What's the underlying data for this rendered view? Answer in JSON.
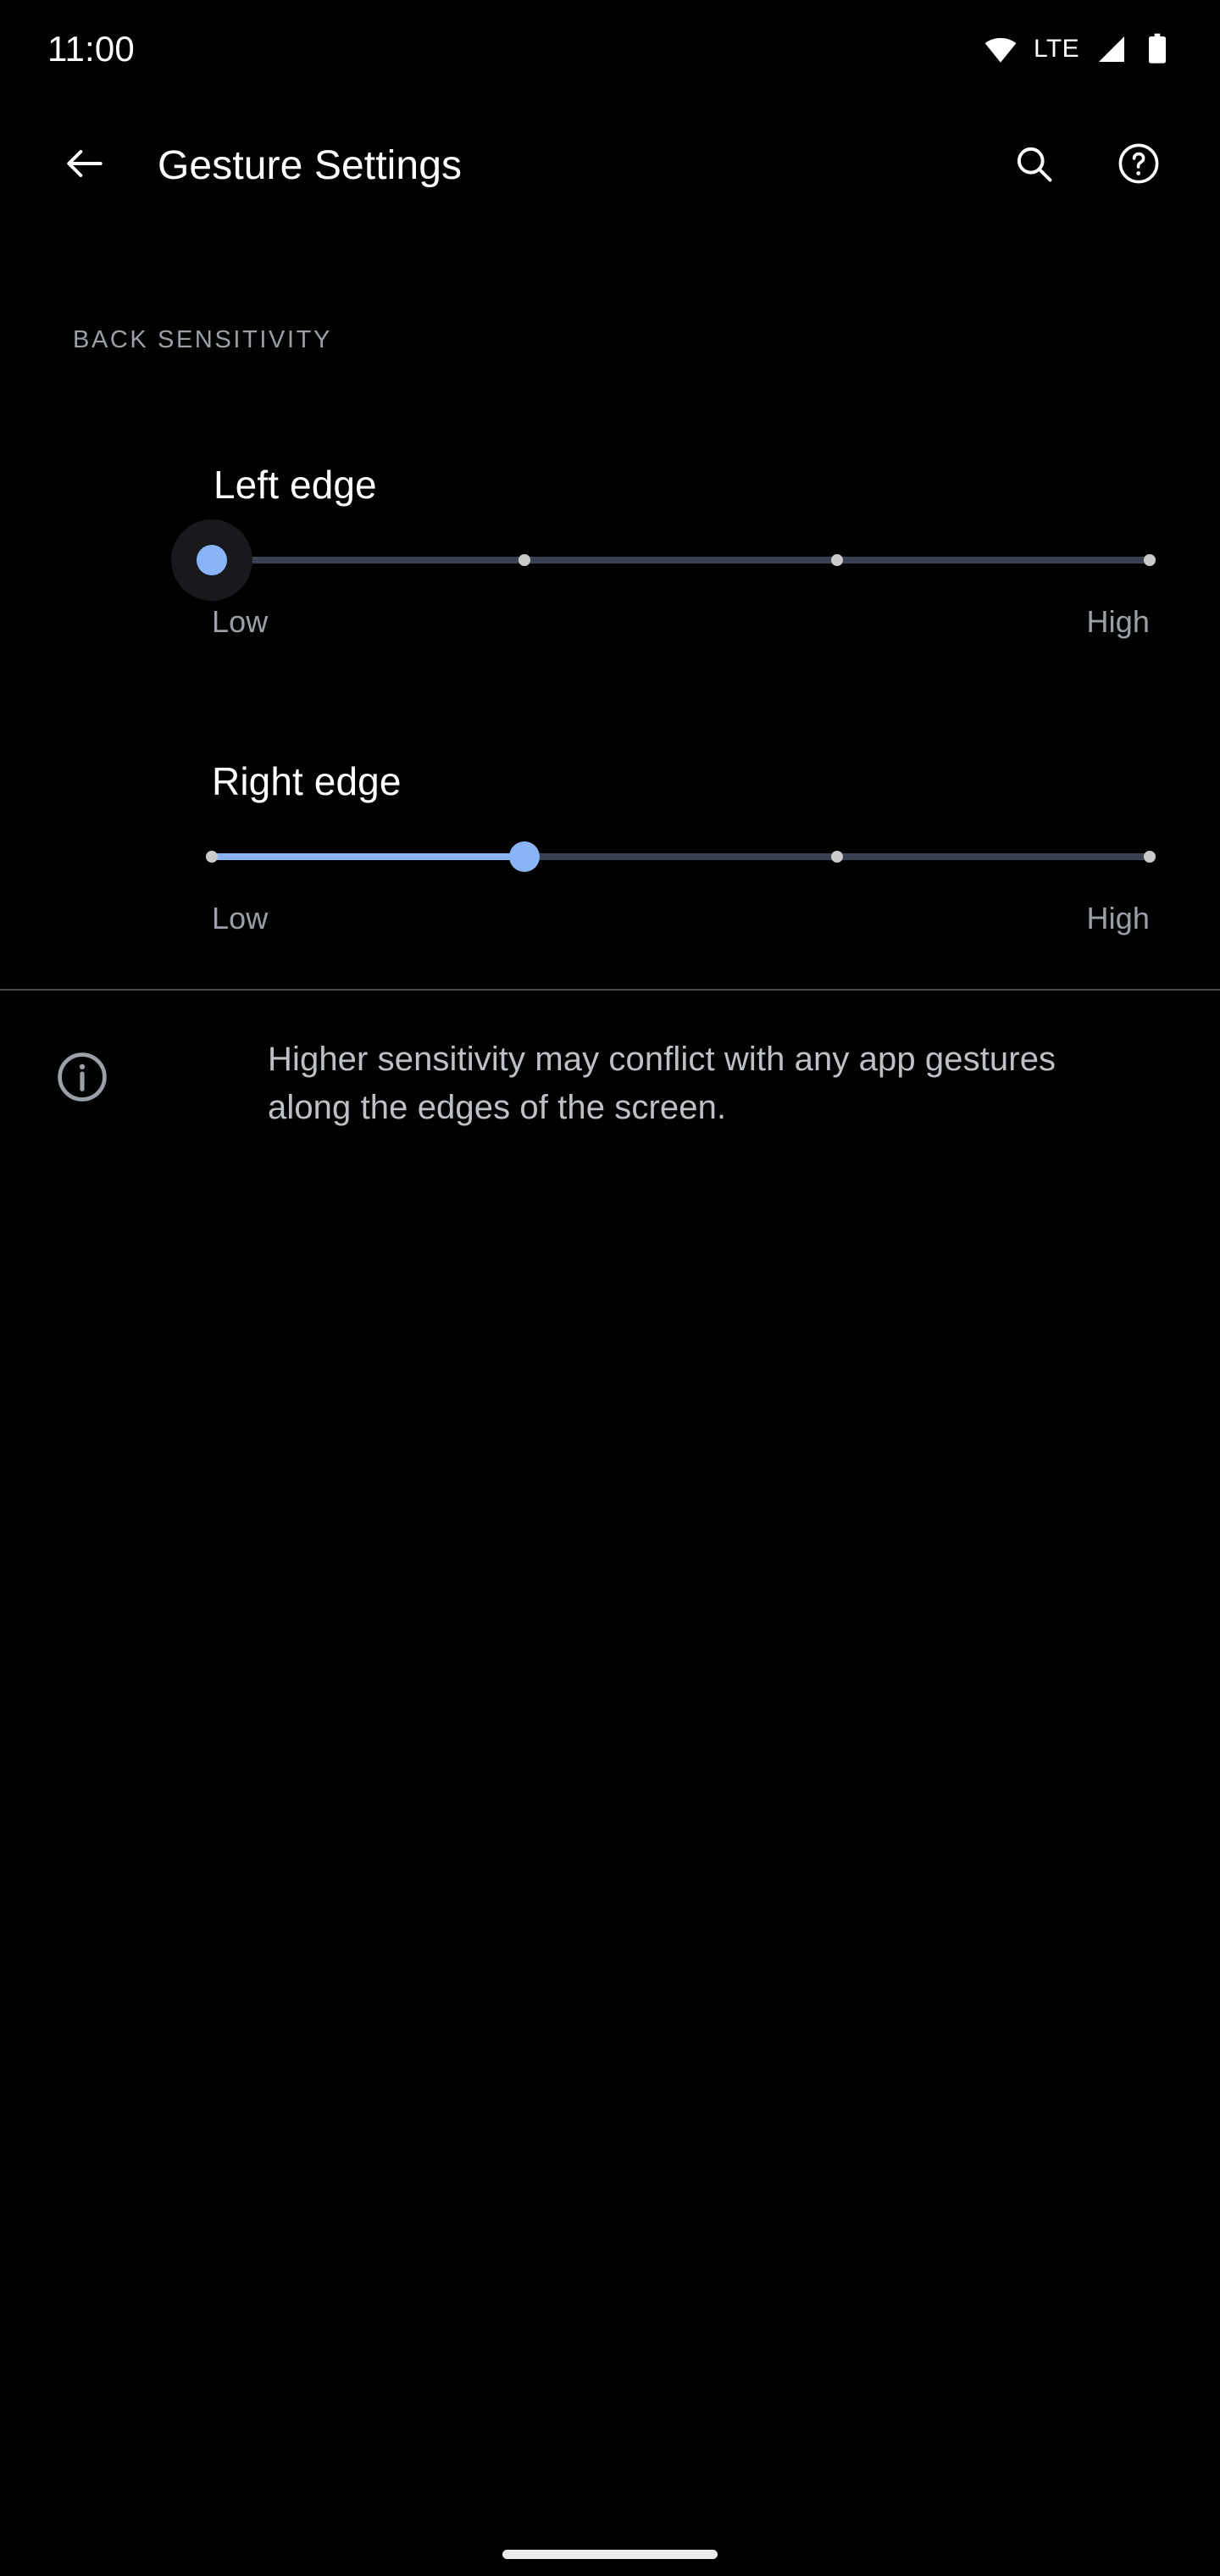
{
  "status_bar": {
    "time": "11:00",
    "network_label": "LTE",
    "icons": [
      "wifi-icon",
      "cellular-signal-icon",
      "battery-icon"
    ]
  },
  "app_bar": {
    "back_icon": "back-arrow-icon",
    "title": "Gesture Settings",
    "search_icon": "search-icon",
    "help_icon": "help-circle-icon"
  },
  "section": {
    "header": "BACK SENSITIVITY"
  },
  "sliders": [
    {
      "id": "left-edge",
      "title": "Left edge",
      "min_label": "Low",
      "max_label": "High",
      "value": 0,
      "min": 0,
      "max": 3,
      "steps": 4,
      "focused": true
    },
    {
      "id": "right-edge",
      "title": "Right edge",
      "min_label": "Low",
      "max_label": "High",
      "value": 1,
      "min": 0,
      "max": 3,
      "steps": 4,
      "focused": false
    }
  ],
  "footer": {
    "info_icon": "info-circle-icon",
    "text": "Higher sensitivity may conflict with any app gestures along the edges of the screen."
  },
  "navigation": {
    "gesture_pill": "home-gesture-pill"
  },
  "colors": {
    "background": "#000000",
    "accent": "#8ab4f8",
    "track_inactive": "#3a4152",
    "secondary_text": "#9aa0a6",
    "body_text": "#bdc1c6",
    "divider": "#4a4a4a"
  }
}
